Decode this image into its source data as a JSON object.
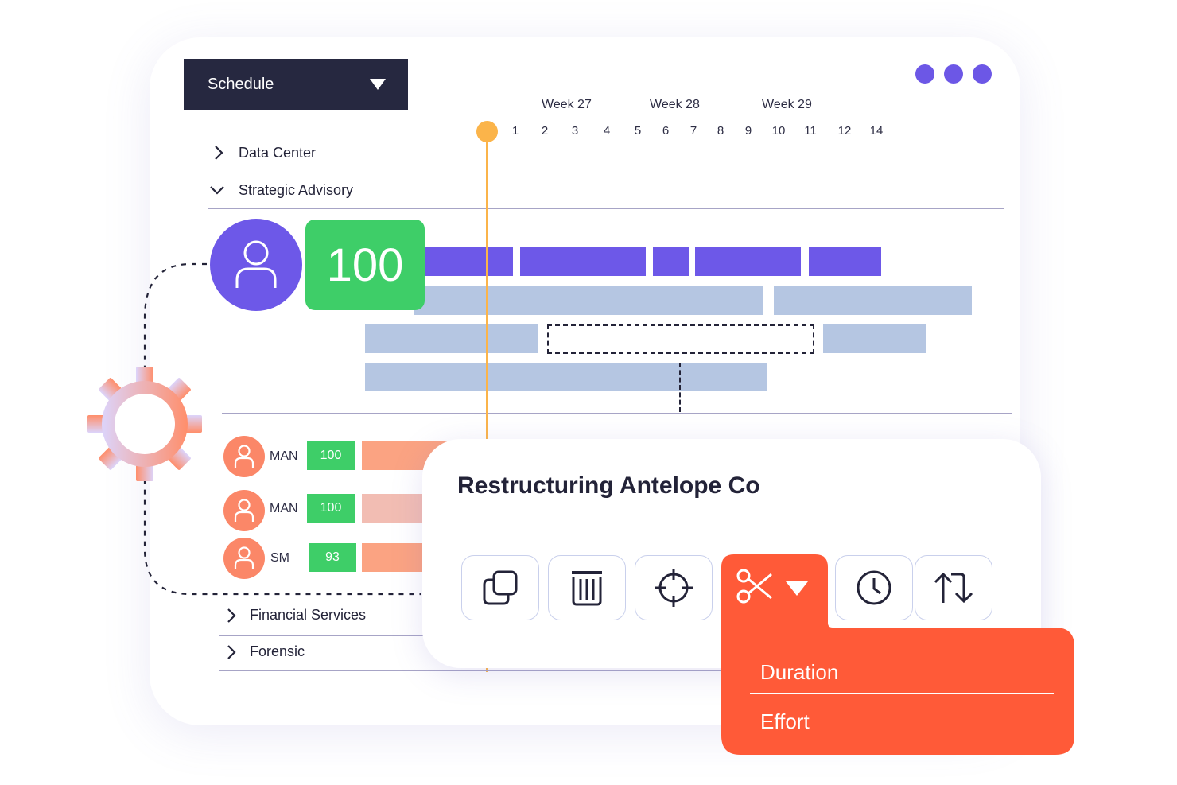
{
  "header": {
    "schedule_label": "Schedule"
  },
  "timeline": {
    "weeks": [
      "Week 27",
      "Week 28",
      "Week 29"
    ],
    "days": [
      "1",
      "2",
      "3",
      "4",
      "5",
      "6",
      "7",
      "8",
      "9",
      "10",
      "11",
      "12",
      "14"
    ]
  },
  "groups": {
    "data_center": "Data Center",
    "strategic_advisory": "Strategic Advisory",
    "financial_services": "Financial Services",
    "forensic": "Forensic"
  },
  "main_resource": {
    "score": "100"
  },
  "resources": [
    {
      "role": "MAN",
      "score": "100"
    },
    {
      "role": "MAN",
      "score": "100"
    },
    {
      "role": "SM",
      "score": "93"
    }
  ],
  "popup": {
    "title": "Restructuring Antelope Co",
    "tools": [
      "copy-icon",
      "delete-icon",
      "target-icon",
      "scissors-icon",
      "clock-icon",
      "swap-icon"
    ]
  },
  "dropdown": {
    "items": [
      "Duration",
      "Effort"
    ]
  },
  "colors": {
    "accent_purple": "#6c57e6",
    "dark_navy": "#262840",
    "green": "#3ece68",
    "orange_red": "#ff5a38",
    "timeline_marker": "#fbb44a",
    "bar_blue": "#b5c6e2",
    "avatar_orange": "#fb8768"
  }
}
